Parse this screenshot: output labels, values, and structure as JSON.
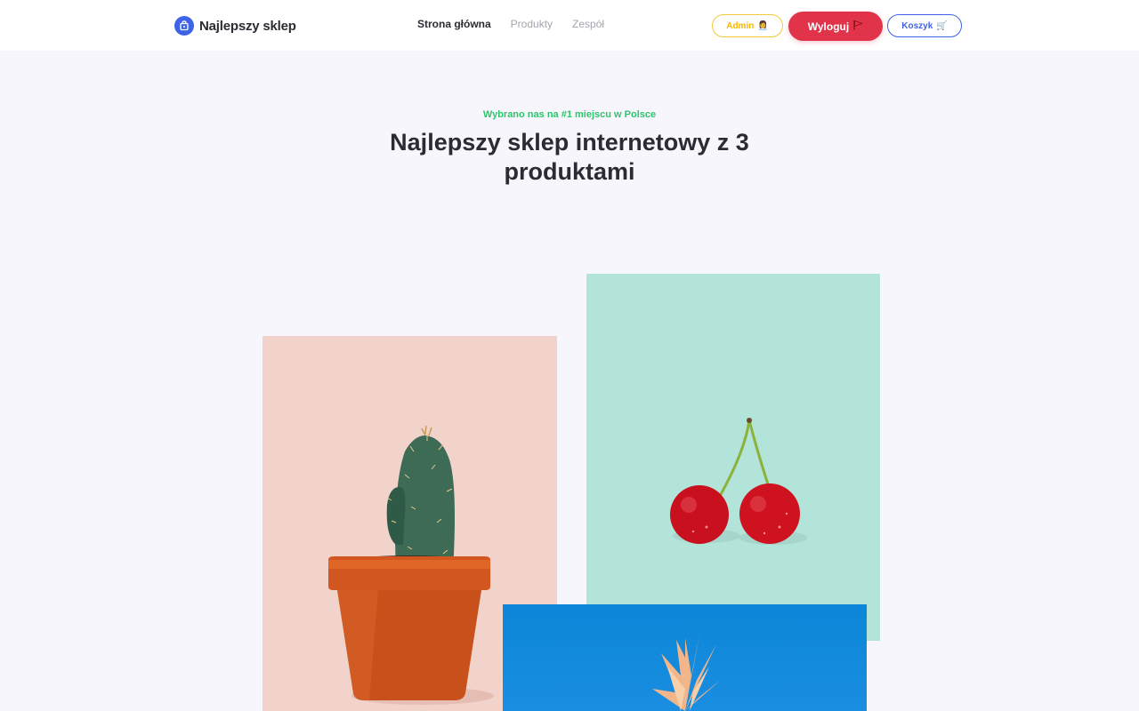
{
  "header": {
    "brand": {
      "name": "Najlepszy sklep",
      "icon": "shopping-bag-icon"
    },
    "nav": [
      {
        "label": "Strona główna",
        "active": true
      },
      {
        "label": "Produkty",
        "active": false
      },
      {
        "label": "Zespół",
        "active": false
      }
    ],
    "buttons": {
      "admin": {
        "label": "Admin",
        "emoji": "👩‍💼"
      },
      "logout": {
        "label": "Wyloguj",
        "emoji": "🚩"
      },
      "cart": {
        "label": "Koszyk",
        "emoji": "🛒"
      }
    }
  },
  "hero": {
    "eyebrow": "Wybrano nas na #1 miejscu w Polsce",
    "title": "Najlepszy sklep internetowy z 3 produktami"
  },
  "products": [
    {
      "name": "cactus",
      "bg": "#f1d3cb"
    },
    {
      "name": "cherry",
      "bg": "#b3e4da"
    },
    {
      "name": "pineapple",
      "bg": "#0c86d8"
    }
  ],
  "colors": {
    "accent": "#3f63e6",
    "danger": "#e1344b",
    "warning": "#f3c93b",
    "success": "#2cc66b",
    "page_bg": "#f8f6fd"
  }
}
